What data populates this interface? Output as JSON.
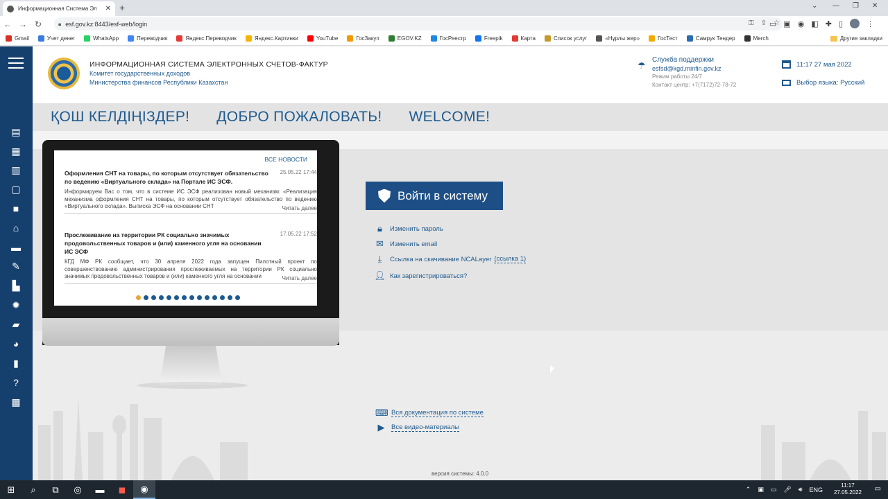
{
  "browser": {
    "tab_title": "Информационная Система Эл",
    "url": "esf.gov.kz:8443/esf-web/login",
    "bookmarks": [
      {
        "label": "Gmail",
        "color": "#d93025"
      },
      {
        "label": "Учет денег",
        "color": "#3b7ddd"
      },
      {
        "label": "WhatsApp",
        "color": "#25d366"
      },
      {
        "label": "Переводчик",
        "color": "#4285f4"
      },
      {
        "label": "Яндекс.Переводчик",
        "color": "#e53935"
      },
      {
        "label": "Яндекс.Картинки",
        "color": "#f4b400"
      },
      {
        "label": "YouTube",
        "color": "#ff0000"
      },
      {
        "label": "ГосЗакуп",
        "color": "#f29900"
      },
      {
        "label": "EGOV.KZ",
        "color": "#2e7d32"
      },
      {
        "label": "ГосРеестр",
        "color": "#1e88e5"
      },
      {
        "label": "Freepik",
        "color": "#1273eb"
      },
      {
        "label": "Карта",
        "color": "#e53935"
      },
      {
        "label": "Список услуг",
        "color": "#c49a2a"
      },
      {
        "label": "«Нұрлы жер»",
        "color": "#555555"
      },
      {
        "label": "ГосТест",
        "color": "#f2a900"
      },
      {
        "label": "Самрук Тендер",
        "color": "#2b6cb0"
      },
      {
        "label": "Merch",
        "color": "#333333"
      }
    ],
    "other_bookmarks": "Другие закладки"
  },
  "header": {
    "title": "ИНФОРМАЦИОННАЯ СИСТЕМА ЭЛЕКТРОННЫХ СЧЕТОВ-ФАКТУР",
    "subtitle1": "Комитет государственных доходов",
    "subtitle2": "Министерства финансов Республики Казахстан",
    "support_title": "Служба поддержки",
    "support_email": "esfsd@kgd.minfin.gov.kz",
    "support_hours": "Режим работы 24/7",
    "support_phone": "Контакт центр: +7(7172)72-78-72",
    "datetime": "11:17 27 мая 2022",
    "language": "Выбор языка: Русский"
  },
  "welcome": [
    "ҚОШ КЕЛДІҢІЗДЕР!",
    "ДОБРО ПОЖАЛОВАТЬ!",
    "WELCOME!"
  ],
  "news": {
    "all_news": "ВСЕ НОВОСТИ",
    "items": [
      {
        "title": "Оформления СНТ на товары, по которым отсутствует обязательство по ведению «Виртуального склада» на Портале ИС ЭСФ.",
        "date": "25.05.22 17:44",
        "text": "Информируем Вас о том, что в системе ИС ЭСФ реализован новый механизм: «Реализация механизма оформления СНТ на товары, по которым отсутствует обязательство по ведению «Виртуального склада». Выписка ЭСФ на основании СНТ",
        "more": "Читать далее"
      },
      {
        "title": "Прослеживание на территории РК социально значимых продовольственных товаров и (или) каменного угля на основании ИС ЭСФ",
        "date": "17.05.22 17:52",
        "text": "КГД МФ РК сообщает, что 30 апреля 2022 года запущен Пилотный проект по совершенствованию администрирования прослеживаемых на территории РК социально значимых продовольственных товаров и (или) каменного угля на основании",
        "more": "Читать далее"
      }
    ],
    "dots_total": 14,
    "dots_active": 0
  },
  "login": {
    "button": "Войти в систему",
    "links": [
      {
        "label": "Изменить пароль",
        "icon": "lock-icon"
      },
      {
        "label": "Изменить email",
        "icon": "envelope-icon"
      },
      {
        "label": "Ссылка на скачивание NCALayer",
        "extra": "(ссылка 1)",
        "icon": "download-icon"
      },
      {
        "label": "Как зарегистрироваться?",
        "icon": "user-add-icon"
      }
    ]
  },
  "docs": {
    "all_docs": "Вся документация по системе",
    "all_videos": "Все видео-материалы"
  },
  "footer": {
    "version": "версия системы: 4.0.0"
  },
  "taskbar": {
    "lang": "ENG",
    "time": "11:17",
    "date": "27.05.2022"
  },
  "colors": {
    "brand_blue": "#1d4f86",
    "sidebar": "#15406e",
    "accent_dot": "#e8a43a"
  }
}
